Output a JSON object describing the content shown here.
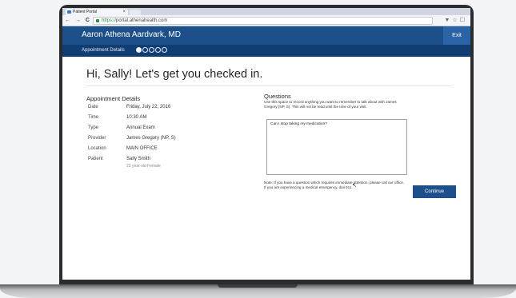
{
  "browser": {
    "tab_title": "Patient Portal",
    "tab_close": "×",
    "url_scheme": "https://",
    "url_rest": "portal.athenahealth.com",
    "nav_icons": {
      "back": "←",
      "forward": "→",
      "reload": "C",
      "home": "⌂"
    },
    "toolbar_icons": "▼☆☐"
  },
  "header": {
    "title": "Aaron Athena Aardvark, MD",
    "exit_label": "Exit"
  },
  "subnav": {
    "label": "Appointment Details",
    "steps_total": 5,
    "current_step": 1
  },
  "main": {
    "greeting": "Hi, Sally! Let's get you checked in.",
    "details_title": "Appointment Details",
    "details": [
      {
        "label": "Date",
        "value": "Friday, July 22, 2016"
      },
      {
        "label": "Time",
        "value": "10:30 AM"
      },
      {
        "label": "Type",
        "value": "Annual Exam"
      },
      {
        "label": "Provider",
        "value": "James Gregory (NP, S)"
      },
      {
        "label": "Location",
        "value": "MAIN OFFICE"
      },
      {
        "label": "Patient",
        "value": "Sally Smith"
      }
    ],
    "patient_sub": "23 year old Female",
    "questions_title": "Questions",
    "questions_help": "Use this space to record anything you want to remember to talk about with James Gregory (NP, S). This will not be read until the time of your visit.",
    "question_text": "Can I stop taking my medication?",
    "note": "Note: If you have a question which requires immediate attention, please call our office. If you are experiencing a medical emergency, dial 911.",
    "continue_label": "Continue"
  },
  "colors": {
    "header_bg": "#1d4f8a",
    "subnav_bg": "#103e73",
    "button_bg": "#1d4f8a"
  }
}
